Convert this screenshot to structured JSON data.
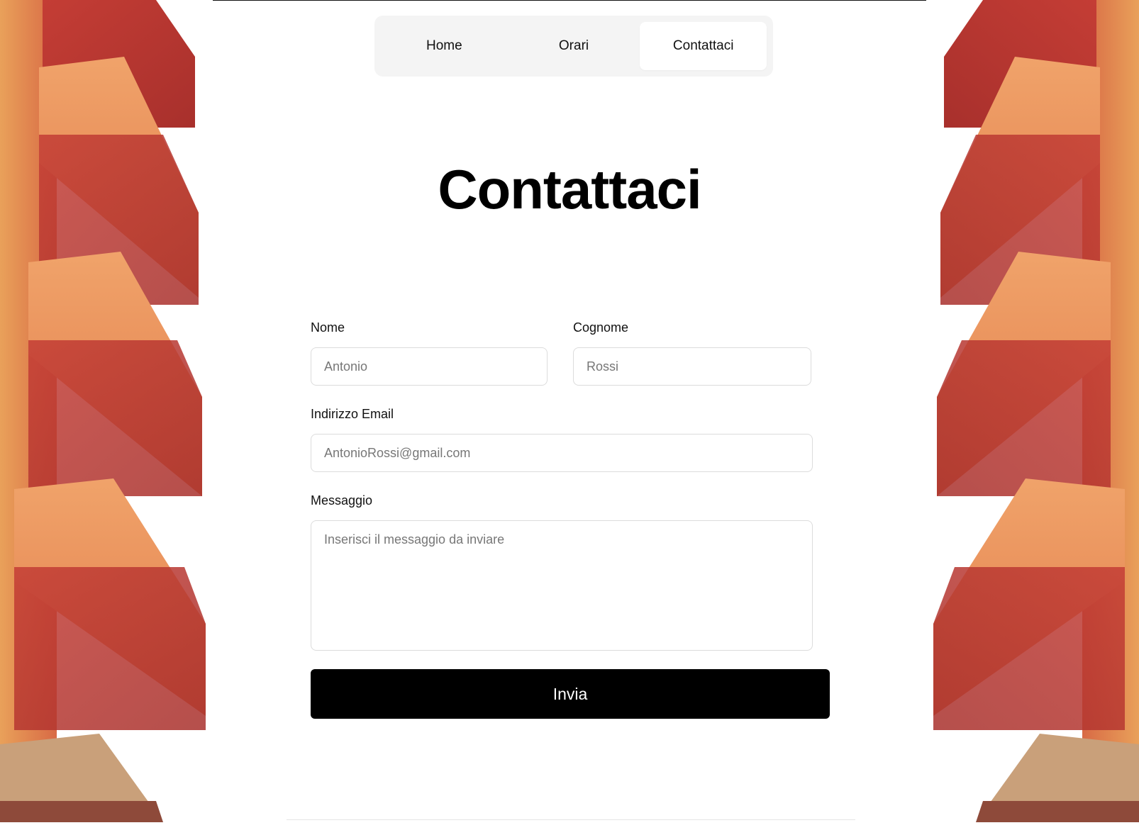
{
  "nav": {
    "tabs": [
      {
        "label": "Home"
      },
      {
        "label": "Orari"
      },
      {
        "label": "Contattaci"
      }
    ],
    "active_index": 2
  },
  "page": {
    "title": "Contattaci"
  },
  "form": {
    "first_name": {
      "label": "Nome",
      "placeholder": "Antonio"
    },
    "last_name": {
      "label": "Cognome",
      "placeholder": "Rossi"
    },
    "email": {
      "label": "Indirizzo Email",
      "placeholder": "AntonioRossi@gmail.com"
    },
    "message": {
      "label": "Messaggio",
      "placeholder": "Inserisci il messaggio da inviare"
    },
    "submit_label": "Invia"
  },
  "colors": {
    "primary_button": "#000000",
    "nav_background": "#f4f4f4",
    "building_orange": "#e88a4a",
    "building_red": "#c4483a"
  }
}
